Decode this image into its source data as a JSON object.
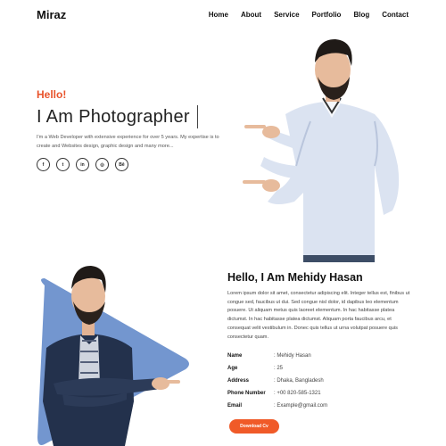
{
  "nav": {
    "logo": "Miraz",
    "items": [
      "Home",
      "About",
      "Service",
      "Portfolio",
      "Blog",
      "Contact"
    ]
  },
  "hero": {
    "greeting": "Hello!",
    "title": "I Am Photographer",
    "description": "I'm a Web Developer with extensive experience for over 5 years. My expertise is to create and Websites design, graphic design and many more...",
    "socials": [
      {
        "icon": "facebook-icon",
        "glyph": "f"
      },
      {
        "icon": "twitter-icon",
        "glyph": "t"
      },
      {
        "icon": "linkedin-icon",
        "glyph": "in"
      },
      {
        "icon": "instagram-icon",
        "glyph": "◎"
      },
      {
        "icon": "behance-icon",
        "glyph": "Bē"
      }
    ]
  },
  "about": {
    "title": "Hello, I Am Mehidy Hasan",
    "text": "Lorem ipsum dolor sit amet, consectetur adipiscing elit. Integer tellus est, finibus ut congue sed, faucibus ut dui. Sed congue nisl dolor, id dapibus leo elementum posuere. Ut aliquam metus quis laoreet elementum. In hac habitasse platea dictumst. In hac habitasse platea dictumst. Aliquam porta faucibus arcu, et consequat velit vestibulum in. Donec quis tellus ut urna volutpat posuere quis consectetur quam.",
    "details": [
      {
        "label": "Name",
        "value": ": Mehidy Hasan"
      },
      {
        "label": "Age",
        "value": ": 25"
      },
      {
        "label": "Address",
        "value": ": Dhaka, Bangladesh"
      },
      {
        "label": "Phone Number",
        "value": ": +00 820-585-1321"
      },
      {
        "label": "Email",
        "value": ": Example@gmail.com"
      }
    ],
    "cv_button": "Download Cv"
  },
  "colors": {
    "accent": "#e8532b",
    "button": "#f05a28",
    "triangle": "#7396cf"
  }
}
